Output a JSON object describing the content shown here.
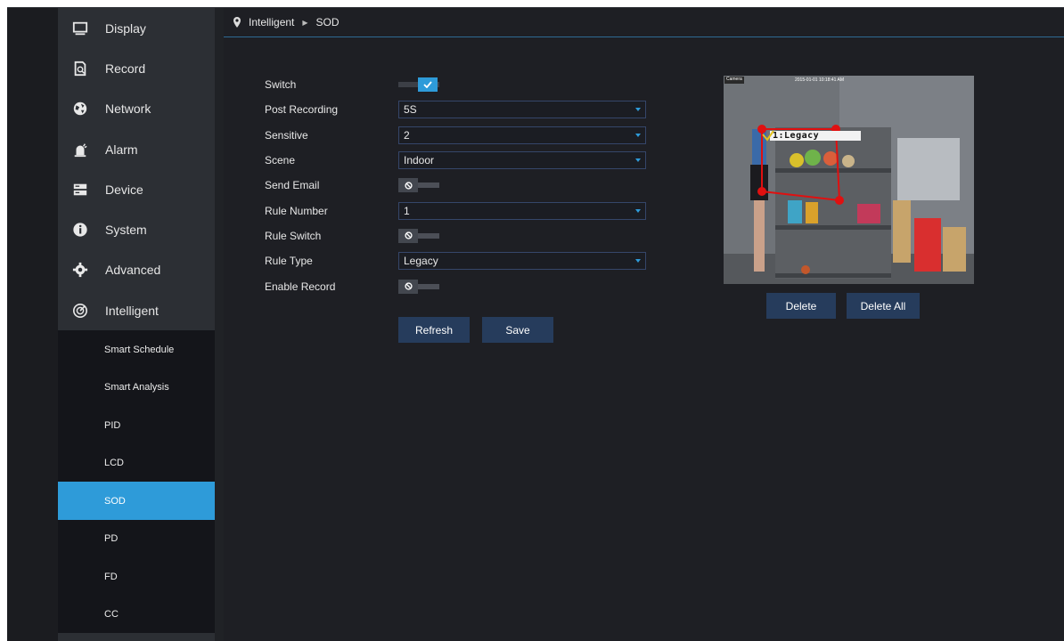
{
  "sidebar": {
    "items": [
      {
        "label": "Display",
        "icon": "monitor-icon"
      },
      {
        "label": "Record",
        "icon": "record-icon"
      },
      {
        "label": "Network",
        "icon": "network-globe-icon"
      },
      {
        "label": "Alarm",
        "icon": "alarm-icon"
      },
      {
        "label": "Device",
        "icon": "device-icon"
      },
      {
        "label": "System",
        "icon": "info-icon"
      },
      {
        "label": "Advanced",
        "icon": "gear-icon"
      },
      {
        "label": "Intelligent",
        "icon": "intelligent-icon"
      }
    ],
    "submenu": [
      "Smart Schedule",
      "Smart Analysis",
      "PID",
      "LCD",
      "SOD",
      "PD",
      "FD",
      "CC"
    ],
    "active_submenu": "SOD"
  },
  "breadcrumb": {
    "parent": "Intelligent",
    "current": "SOD"
  },
  "form": {
    "switch": {
      "label": "Switch",
      "state": "on"
    },
    "post_recording": {
      "label": "Post Recording",
      "value": "5S"
    },
    "sensitive": {
      "label": "Sensitive",
      "value": "2"
    },
    "scene": {
      "label": "Scene",
      "value": "Indoor"
    },
    "send_email": {
      "label": "Send Email",
      "state": "off"
    },
    "rule_number": {
      "label": "Rule Number",
      "value": "1"
    },
    "rule_switch": {
      "label": "Rule Switch",
      "state": "off"
    },
    "rule_type": {
      "label": "Rule Type",
      "value": "Legacy"
    },
    "enable_record": {
      "label": "Enable Record",
      "state": "off"
    }
  },
  "actions": {
    "refresh": "Refresh",
    "save": "Save"
  },
  "preview": {
    "camera_label": "Camera",
    "timestamp": "2015-01-01 10:18:41 AM",
    "rule_label": "1:Legacy",
    "delete": "Delete",
    "delete_all": "Delete All"
  },
  "colors": {
    "accent": "#2e9bd9",
    "rule_line": "#e01010",
    "button": "#263c5c"
  }
}
